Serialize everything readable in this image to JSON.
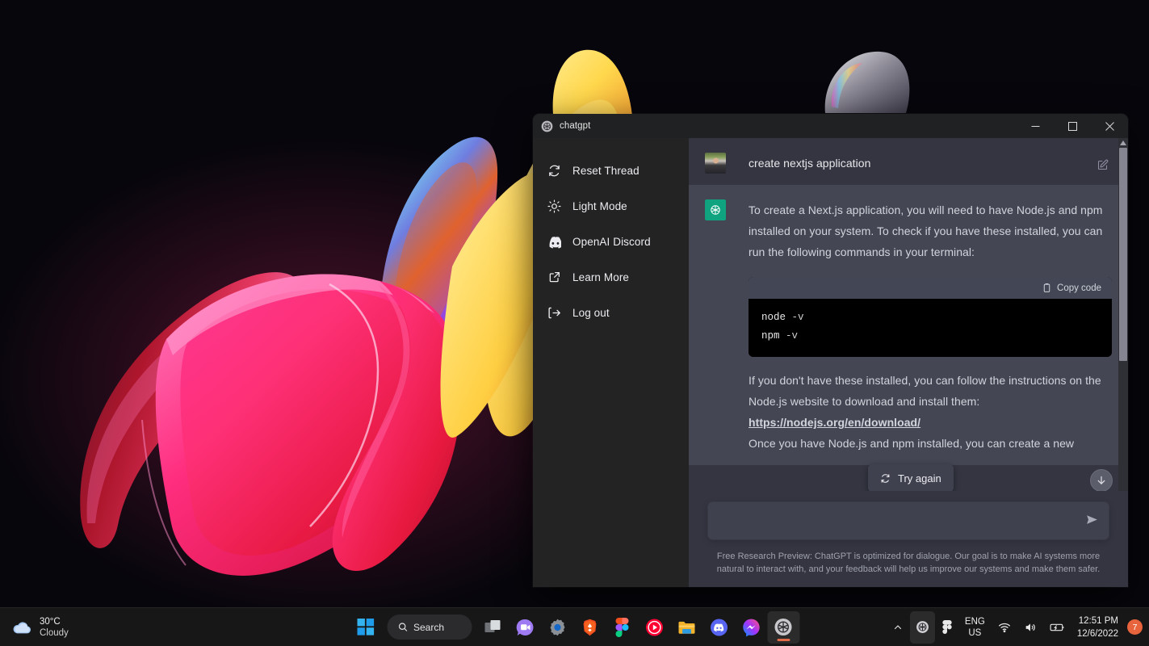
{
  "window": {
    "title": "chatgpt",
    "logo_icon": "openai-logo-icon",
    "minimize_icon": "minimize-icon",
    "maximize_icon": "maximize-icon",
    "close_icon": "close-icon"
  },
  "sidebar": {
    "items": [
      {
        "label": "Reset Thread",
        "icon": "reset-icon"
      },
      {
        "label": "Light Mode",
        "icon": "sun-icon"
      },
      {
        "label": "OpenAI Discord",
        "icon": "discord-icon"
      },
      {
        "label": "Learn More",
        "icon": "external-link-icon"
      },
      {
        "label": "Log out",
        "icon": "logout-icon"
      }
    ]
  },
  "chat": {
    "user_message": {
      "text": "create nextjs application",
      "avatar": "user-avatar",
      "edit_icon": "edit-icon"
    },
    "bot_message": {
      "avatar": "openai-avatar",
      "paragraph1": "To create a Next.js application, you will need to have Node.js and npm installed on your system. To check if you have these installed, you can run the following commands in your terminal:",
      "code_copy_label": "Copy code",
      "code_copy_icon": "clipboard-icon",
      "code_lines": [
        {
          "cmd": "node",
          "arg": "-v"
        },
        {
          "cmd": "npm",
          "arg": "-v"
        }
      ],
      "paragraph2": "If you don't have these installed, you can follow the instructions on the Node.js website to download and install them:",
      "link_text": "https://nodejs.org/en/download/",
      "paragraph3_partial": "Once you have Node.js and npm installed, you can create a new"
    },
    "try_again": {
      "label": "Try again",
      "icon": "refresh-icon"
    },
    "scroll_down_icon": "arrow-down-icon",
    "scrollbar_up_icon": "caret-up-icon"
  },
  "composer": {
    "value": "",
    "placeholder": "",
    "send_icon": "send-icon"
  },
  "footnote": "Free Research Preview: ChatGPT is optimized for dialogue. Our goal is to make AI systems more natural to interact with, and your feedback will help us improve our systems and make them safer.",
  "taskbar": {
    "weather": {
      "temperature": "30°C",
      "condition": "Cloudy",
      "icon": "cloud-icon"
    },
    "start_icon": "windows-start-icon",
    "search": {
      "label": "Search",
      "icon": "search-icon"
    },
    "apps": [
      {
        "name": "task-view-icon"
      },
      {
        "name": "zoom-icon"
      },
      {
        "name": "settings-icon"
      },
      {
        "name": "brave-icon"
      },
      {
        "name": "figma-icon"
      },
      {
        "name": "youtube-music-icon"
      },
      {
        "name": "file-explorer-icon"
      },
      {
        "name": "discord-icon"
      },
      {
        "name": "messenger-icon"
      },
      {
        "name": "chatgpt-icon"
      }
    ],
    "tray": {
      "chevron_icon": "chevron-up-icon",
      "openai_tray_icon": "openai-tray-icon",
      "figma_tray_icon": "figma-tray-icon",
      "language_primary": "ENG",
      "language_secondary": "US",
      "wifi_icon": "wifi-icon",
      "volume_icon": "volume-icon",
      "battery_icon": "battery-charging-icon",
      "time": "12:51 PM",
      "date": "12/6/2022",
      "notification_count": "7"
    }
  },
  "colors": {
    "accent_green": "#10a37f",
    "chat_user_bg": "#343541",
    "chat_bot_bg": "#444654",
    "sidebar_bg": "#232323",
    "titlebar_bg": "#202123",
    "notification_badge": "#e8643c"
  }
}
